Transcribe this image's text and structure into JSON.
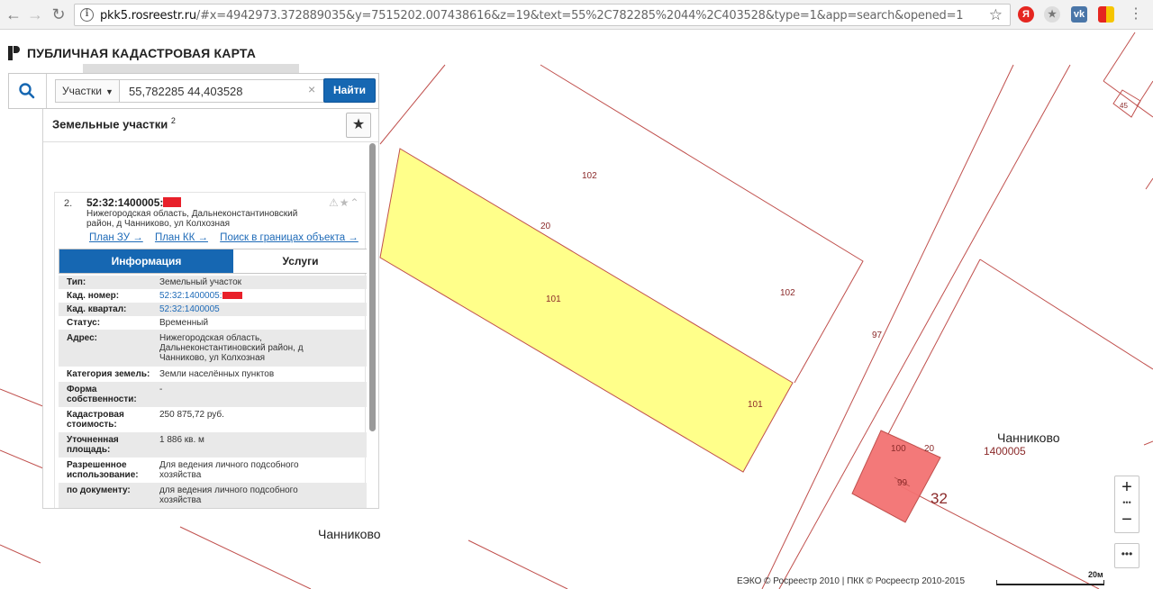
{
  "browser": {
    "url_host": "pkk5.rosreestr.ru",
    "url_path": "/#x=4942973.372889035&y=7515202.007438616&z=19&text=55%2C782285%2044%2C403528&type=1&app=search&opened=1"
  },
  "app": {
    "title": "ПУБЛИЧНАЯ КАДАСТРОВАЯ КАРТА"
  },
  "search": {
    "type_label": "Участки",
    "query": "55,782285 44,403528",
    "find_label": "Найти",
    "clear_symbol": "×"
  },
  "results": {
    "title": "Земельные участки",
    "count": "2"
  },
  "parcel": {
    "index": "2.",
    "cad_number_prefix": "52:32:1400005:",
    "address_short": "Нижегородская область, Дальнеконстантиновский район, д Чанниково, ул Колхозная",
    "links": [
      "План ЗУ →",
      "План КК →",
      "Поиск в границах объекта →"
    ],
    "tabs": {
      "info": "Информация",
      "services": "Услуги"
    },
    "fields": [
      {
        "label": "Тип:",
        "value": "Земельный участок",
        "link": false
      },
      {
        "label": "Кад. номер:",
        "value": "52:32:1400005:",
        "link": true
      },
      {
        "label": "Кад. квартал:",
        "value": "52:32:1400005",
        "link": true
      },
      {
        "label": "Статус:",
        "value": "Временный",
        "link": false
      },
      {
        "label": "Адрес:",
        "value": "Нижегородская область, Дальнеконстантиновский район, д Чанниково, ул Колхозная",
        "link": false
      },
      {
        "label": "Категория земель:",
        "value": "Земли населённых пунктов",
        "link": false
      },
      {
        "label": "Форма собственности:",
        "value": "-",
        "link": false
      },
      {
        "label": "Кадастровая стоимость:",
        "value": "250 875,72 руб.",
        "link": false
      },
      {
        "label": "Уточненная площадь:",
        "value": "1 886 кв. м",
        "link": false
      },
      {
        "label": "Разрешенное использование:",
        "value": "Для ведения личного подсобного хозяйства",
        "link": false
      },
      {
        "label": "по документу:",
        "value": "для ведения личного подсобного хозяйства",
        "link": false
      }
    ]
  },
  "map": {
    "labels": {
      "p102a": "102",
      "p102b": "102",
      "p101a": "101",
      "p101b": "101",
      "p20a": "20",
      "p20b": "20",
      "p97": "97",
      "p100": "100",
      "p99": "99",
      "p32": "32",
      "p45": "45"
    },
    "place_main": "Чанниково",
    "place_quarter": "1400005",
    "place_bottom": "Чанниково"
  },
  "controls": {
    "zoom_in": "+",
    "zoom_out": "−",
    "dots": "•••",
    "more": "•••"
  },
  "footer": {
    "copyright": "ЕЭКО © Росреестр 2010 | ПКК © Росреестр 2010-2015",
    "scale": "20м"
  },
  "colors": {
    "accent": "#1667b2",
    "parcel_selected": "#ffff8a",
    "parcel_highlight": "#f06b6b",
    "boundary": "#c0504d"
  }
}
